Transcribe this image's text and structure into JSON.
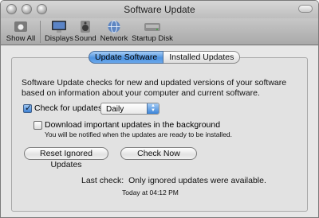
{
  "window": {
    "title": "Software Update"
  },
  "toolbar": {
    "items": [
      {
        "label": "Show All",
        "icon": "apple-grid-icon"
      },
      {
        "label": "Displays",
        "icon": "display-icon"
      },
      {
        "label": "Sound",
        "icon": "speaker-icon"
      },
      {
        "label": "Network",
        "icon": "network-globe-icon"
      },
      {
        "label": "Startup Disk",
        "icon": "hard-disk-icon"
      }
    ]
  },
  "tabs": [
    {
      "label": "Update Software",
      "active": true
    },
    {
      "label": "Installed Updates",
      "active": false
    }
  ],
  "description": "Software Update checks for new and updated versions of your software based on information about your computer and current software.",
  "check_for_updates": {
    "label": "Check for updates:",
    "checked": true,
    "frequency": "Daily"
  },
  "download_background": {
    "label": "Download important updates in the background",
    "checked": false,
    "note": "You will be notified when the updates are ready to be installed."
  },
  "buttons": {
    "reset": "Reset Ignored Updates",
    "check_now": "Check Now"
  },
  "status": {
    "label": "Last check:",
    "value": "Only ignored updates were available.",
    "time": "Today at 04:12 PM"
  },
  "colors": {
    "accent": "#4e93e0",
    "window_bg": "#e6e6e6"
  }
}
